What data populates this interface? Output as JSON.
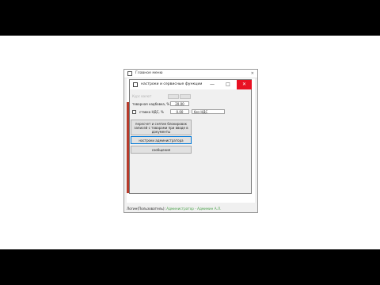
{
  "main_window": {
    "title": "Главное меню",
    "close_glyph": "✕",
    "status_label": "Логин(Пользователь):",
    "status_value": "Администратор - Адмимин А.Л."
  },
  "dialog": {
    "title": "настроки и сервисные функции",
    "buttons": {
      "minimize": "—",
      "maximize": "□",
      "close": "✕"
    },
    "disabled_label": "Курс валют",
    "markup_label": "товарная надбавка, %",
    "markup_value": "20.00",
    "vat_label": "ставка НДС, %",
    "vat_value": "0.00",
    "vat_option": "без НДС",
    "btn_recalc": "пересчет и снятие блокировок записей с товарами при вводе в документы",
    "btn_admin": "настроки администратора",
    "btn_messages": "сообщения"
  },
  "colors": {
    "close_red": "#e81123",
    "status_green": "#4aa04a",
    "focus_blue": "#0078d7"
  }
}
